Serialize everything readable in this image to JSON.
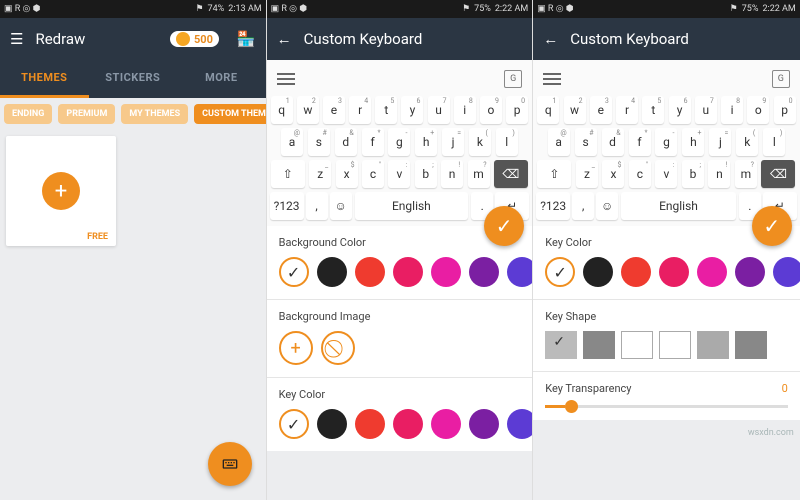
{
  "status": {
    "battery": "74%",
    "time1": "2:13 AM",
    "battery2": "75%",
    "time2": "2:22 AM"
  },
  "pane1": {
    "title": "Redraw",
    "coins": "500",
    "tabs": [
      "THEMES",
      "STICKERS",
      "MORE"
    ],
    "chips": [
      "ENDING",
      "PREMIUM",
      "MY THEMES",
      "CUSTOM THEMES"
    ],
    "card_label": "FREE"
  },
  "pane2": {
    "title": "Custom Keyboard",
    "rows": {
      "r1": [
        [
          "q",
          "1"
        ],
        [
          "w",
          "2"
        ],
        [
          "e",
          "3"
        ],
        [
          "r",
          "4"
        ],
        [
          "t",
          "5"
        ],
        [
          "y",
          "6"
        ],
        [
          "u",
          "7"
        ],
        [
          "i",
          "8"
        ],
        [
          "o",
          "9"
        ],
        [
          "p",
          "0"
        ]
      ],
      "r2": [
        [
          "a",
          "@"
        ],
        [
          "s",
          "#"
        ],
        [
          "d",
          "&"
        ],
        [
          "f",
          "*"
        ],
        [
          "g",
          "-"
        ],
        [
          "h",
          "+"
        ],
        [
          "j",
          "="
        ],
        [
          "k",
          "("
        ],
        [
          "l",
          ")"
        ]
      ],
      "r3": [
        [
          "z",
          "_"
        ],
        [
          "x",
          "$"
        ],
        [
          "c",
          "\""
        ],
        [
          "v",
          ":"
        ],
        [
          "b",
          ";"
        ],
        [
          "n",
          "!"
        ],
        [
          "m",
          "?"
        ]
      ],
      "sym": "?123",
      "lang": "English"
    },
    "sections": {
      "bg": "Background Color",
      "bgimg": "Background Image",
      "keycolor": "Key Color"
    },
    "colors": [
      "#222",
      "#ef3b2f",
      "#e91e63",
      "#e91ea3",
      "#7b1fa2",
      "#5c3bd4",
      "#3b4fd4"
    ]
  },
  "pane3": {
    "title": "Custom Keyboard",
    "sections": {
      "keycolor": "Key Color",
      "keyshape": "Key Shape",
      "keytrans": "Key Transparency"
    },
    "transparency": "0"
  },
  "watermark": "wsxdn.com"
}
